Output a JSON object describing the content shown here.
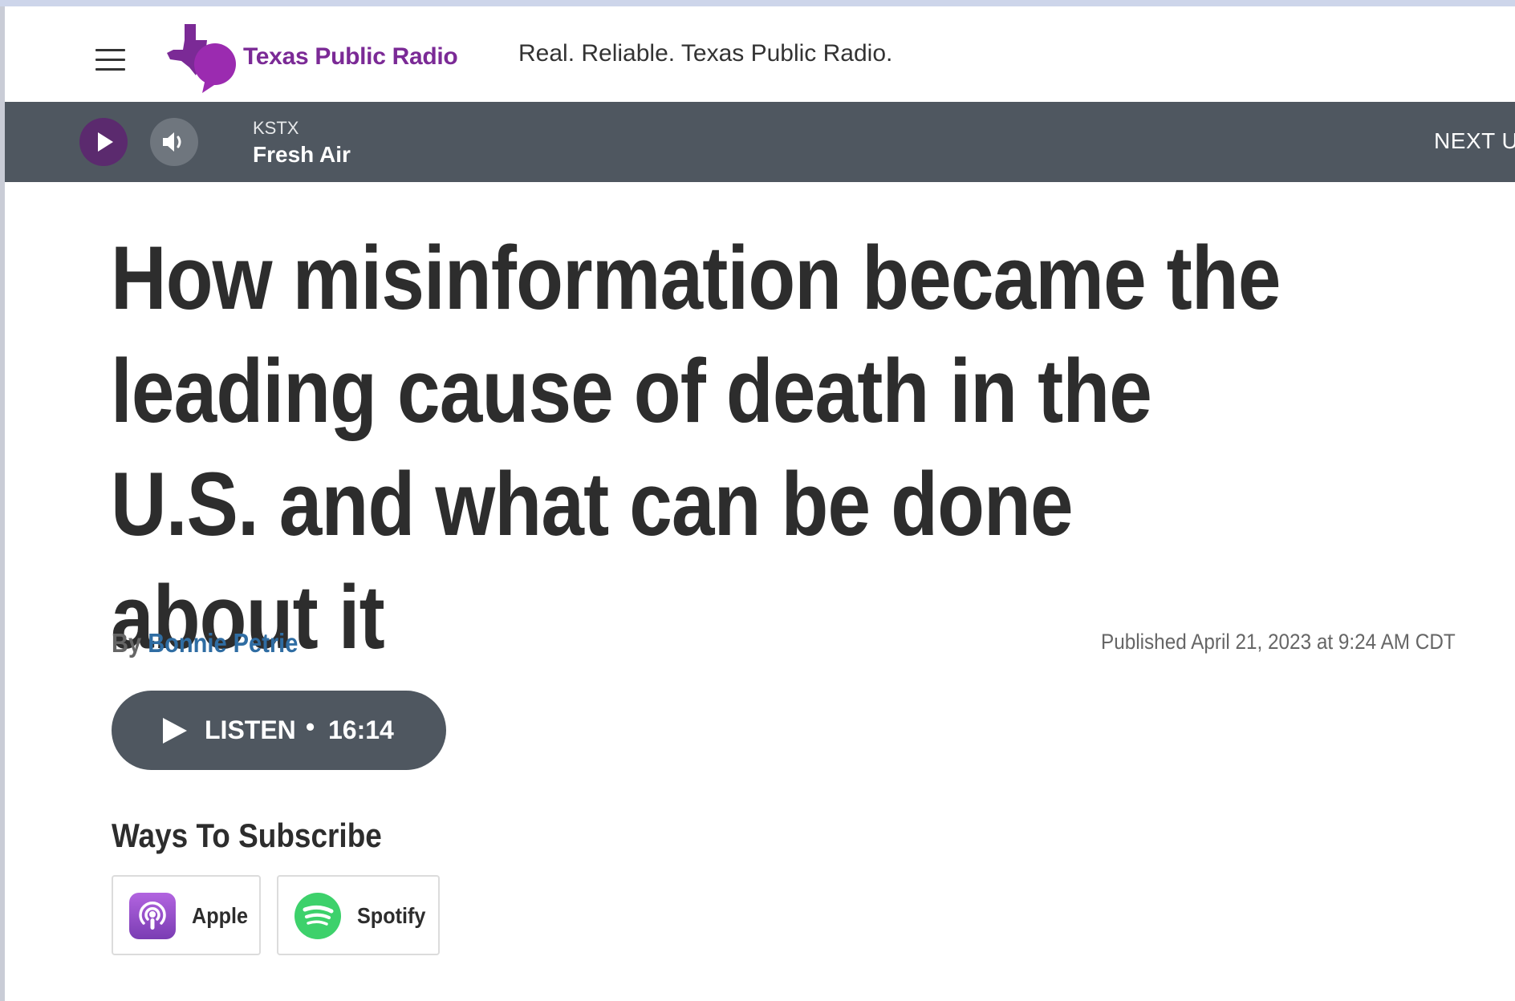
{
  "header": {
    "logo_text": "Texas Public Radio",
    "tagline": "Real. Reliable. Texas Public Radio."
  },
  "player": {
    "station": "KSTX",
    "program": "Fresh Air",
    "next_label": "NEXT U"
  },
  "article": {
    "headline": "How misinformation became the leading cause of death in the U.S. and what can be done about it",
    "by_prefix": "By ",
    "author": "Bonnie Petrie",
    "published": "Published April 21, 2023 at 9:24 AM CDT"
  },
  "listen": {
    "label": "LISTEN",
    "separator": "•",
    "duration": "16:14"
  },
  "subscribe": {
    "title": "Ways To Subscribe",
    "options": [
      {
        "label": "Apple",
        "icon": "apple-podcasts-icon",
        "color": "#8e4ec6"
      },
      {
        "label": "Spotify",
        "icon": "spotify-icon",
        "color": "#3dd16b"
      }
    ]
  },
  "colors": {
    "brand_purple": "#7b2a96",
    "player_bar": "#4f5760",
    "play_button": "#5b2a6e",
    "author_link": "#2f6da3"
  }
}
